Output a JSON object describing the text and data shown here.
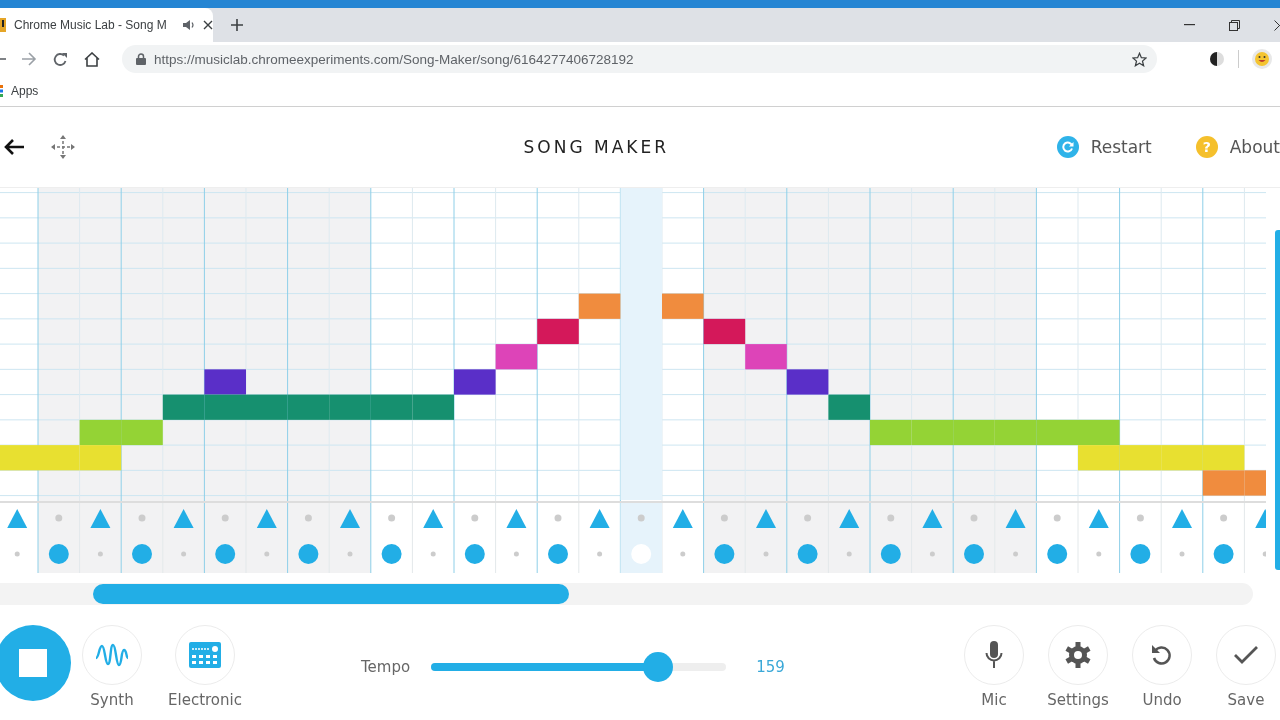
{
  "browser": {
    "tab": {
      "title": "Chrome Music Lab - Song M"
    },
    "url": "https://musiclab.chromeexperiments.com/Song-Maker/song/6164277406728192",
    "bookmarks": [
      {
        "label": "Apps"
      }
    ]
  },
  "app": {
    "title": "SONG MAKER",
    "restart": {
      "label": "Restart"
    },
    "about": {
      "icon": "?",
      "label": "About"
    }
  },
  "grid": {
    "rows": [
      {
        "on": [
          false,
          false,
          false,
          false,
          false,
          false,
          false,
          false,
          false,
          false,
          false,
          false,
          false,
          false,
          false,
          false,
          false,
          false,
          false,
          false,
          false,
          false,
          false,
          false,
          false,
          false,
          false,
          false,
          false,
          false,
          false
        ]
      },
      {
        "on": [
          false,
          false,
          false,
          false,
          false,
          false,
          false,
          false,
          false,
          false,
          false,
          false,
          false,
          false,
          false,
          false,
          false,
          false,
          false,
          false,
          false,
          false,
          false,
          false,
          false,
          false,
          false,
          false,
          false,
          false,
          false
        ]
      },
      {
        "on": [
          false,
          false,
          false,
          false,
          false,
          false,
          false,
          false,
          false,
          false,
          false,
          false,
          false,
          false,
          false,
          false,
          false,
          false,
          false,
          false,
          false,
          false,
          false,
          false,
          false,
          false,
          false,
          false,
          false,
          false,
          false
        ]
      },
      {
        "on": [
          false,
          false,
          false,
          false,
          false,
          false,
          false,
          false,
          false,
          false,
          false,
          false,
          false,
          false,
          false,
          false,
          false,
          false,
          false,
          false,
          false,
          false,
          false,
          false,
          false,
          false,
          false,
          false,
          false,
          false,
          false
        ]
      },
      {
        "color": "#f08c3e",
        "on": [
          false,
          false,
          false,
          false,
          false,
          false,
          false,
          false,
          false,
          false,
          false,
          false,
          false,
          false,
          true,
          false,
          true,
          false,
          false,
          false,
          false,
          false,
          false,
          false,
          false,
          false,
          false,
          false,
          false,
          false,
          false
        ]
      },
      {
        "color": "#d4185a",
        "on": [
          false,
          false,
          false,
          false,
          false,
          false,
          false,
          false,
          false,
          false,
          false,
          false,
          false,
          true,
          false,
          false,
          false,
          true,
          false,
          false,
          false,
          false,
          false,
          false,
          false,
          false,
          false,
          false,
          false,
          false,
          false
        ]
      },
      {
        "color": "#dd44b8",
        "on": [
          false,
          false,
          false,
          false,
          false,
          false,
          false,
          false,
          false,
          false,
          false,
          false,
          true,
          false,
          false,
          false,
          false,
          false,
          true,
          false,
          false,
          false,
          false,
          false,
          false,
          false,
          false,
          false,
          false,
          false,
          false
        ]
      },
      {
        "color": "#5a2fc8",
        "on": [
          false,
          false,
          false,
          false,
          false,
          true,
          false,
          false,
          false,
          false,
          false,
          true,
          false,
          false,
          false,
          false,
          false,
          false,
          false,
          true,
          false,
          false,
          false,
          false,
          false,
          false,
          false,
          false,
          false,
          false,
          false
        ]
      },
      {
        "color": "#16906f",
        "on": [
          false,
          false,
          false,
          false,
          true,
          true,
          true,
          true,
          true,
          true,
          true,
          false,
          false,
          false,
          false,
          false,
          false,
          false,
          false,
          false,
          true,
          false,
          false,
          false,
          false,
          false,
          false,
          false,
          false,
          false,
          false
        ]
      },
      {
        "color": "#94d335",
        "on": [
          false,
          false,
          true,
          true,
          false,
          false,
          false,
          false,
          false,
          false,
          false,
          false,
          false,
          false,
          false,
          false,
          false,
          false,
          false,
          false,
          false,
          true,
          true,
          true,
          true,
          true,
          true,
          false,
          false,
          false,
          false
        ]
      },
      {
        "color": "#e8e030",
        "on": [
          true,
          true,
          true,
          false,
          false,
          false,
          false,
          false,
          false,
          false,
          false,
          false,
          false,
          false,
          false,
          false,
          false,
          false,
          false,
          false,
          false,
          false,
          false,
          false,
          false,
          false,
          true,
          true,
          true,
          true,
          false
        ]
      },
      {
        "color": "#f08c3e",
        "on": [
          false,
          false,
          false,
          false,
          false,
          false,
          false,
          false,
          false,
          false,
          false,
          false,
          false,
          false,
          false,
          false,
          false,
          false,
          false,
          false,
          false,
          false,
          false,
          false,
          false,
          false,
          false,
          false,
          false,
          true,
          true
        ]
      }
    ],
    "columns": [
      {
        "playing": false
      },
      {
        "playing": false
      },
      {
        "playing": false
      },
      {
        "playing": false
      },
      {
        "playing": false
      },
      {
        "playing": false
      },
      {
        "playing": false
      },
      {
        "playing": false
      },
      {
        "playing": false
      },
      {
        "playing": false
      },
      {
        "playing": false
      },
      {
        "playing": false
      },
      {
        "playing": false
      },
      {
        "playing": false
      },
      {
        "playing": false
      },
      {
        "playing": true
      },
      {
        "playing": false
      },
      {
        "playing": false
      },
      {
        "playing": false
      },
      {
        "playing": false
      },
      {
        "playing": false
      },
      {
        "playing": false
      },
      {
        "playing": false
      },
      {
        "playing": false
      },
      {
        "playing": false
      },
      {
        "playing": false
      },
      {
        "playing": false
      },
      {
        "playing": false
      },
      {
        "playing": false
      },
      {
        "playing": false
      },
      {
        "playing": false
      }
    ]
  },
  "rhythm": {
    "rows": [
      {
        "kind": "triangle",
        "on": [
          true,
          false,
          true,
          false,
          true,
          false,
          true,
          false,
          true,
          false,
          true,
          false,
          true,
          false,
          true,
          false,
          true,
          false,
          true,
          false,
          true,
          false,
          true,
          false,
          true,
          false,
          true,
          false,
          true,
          false,
          true
        ]
      },
      {
        "kind": "circle",
        "on": [
          false,
          true,
          false,
          true,
          false,
          true,
          false,
          true,
          false,
          true,
          false,
          true,
          false,
          true,
          false,
          true,
          false,
          true,
          false,
          true,
          false,
          true,
          false,
          true,
          false,
          true,
          false,
          true,
          false,
          true,
          false
        ]
      }
    ]
  },
  "controls": {
    "playing": true,
    "instruments": [
      {
        "kind": "synth",
        "label": "Synth"
      },
      {
        "kind": "electronic",
        "label": "Electronic"
      }
    ],
    "tempo": {
      "label": "Tempo",
      "level": 0.77,
      "value": "159"
    },
    "actions": [
      {
        "kind": "mic",
        "label": "Mic"
      },
      {
        "kind": "settings",
        "label": "Settings"
      },
      {
        "kind": "undo",
        "label": "Undo"
      },
      {
        "kind": "save",
        "label": "Save"
      }
    ]
  }
}
